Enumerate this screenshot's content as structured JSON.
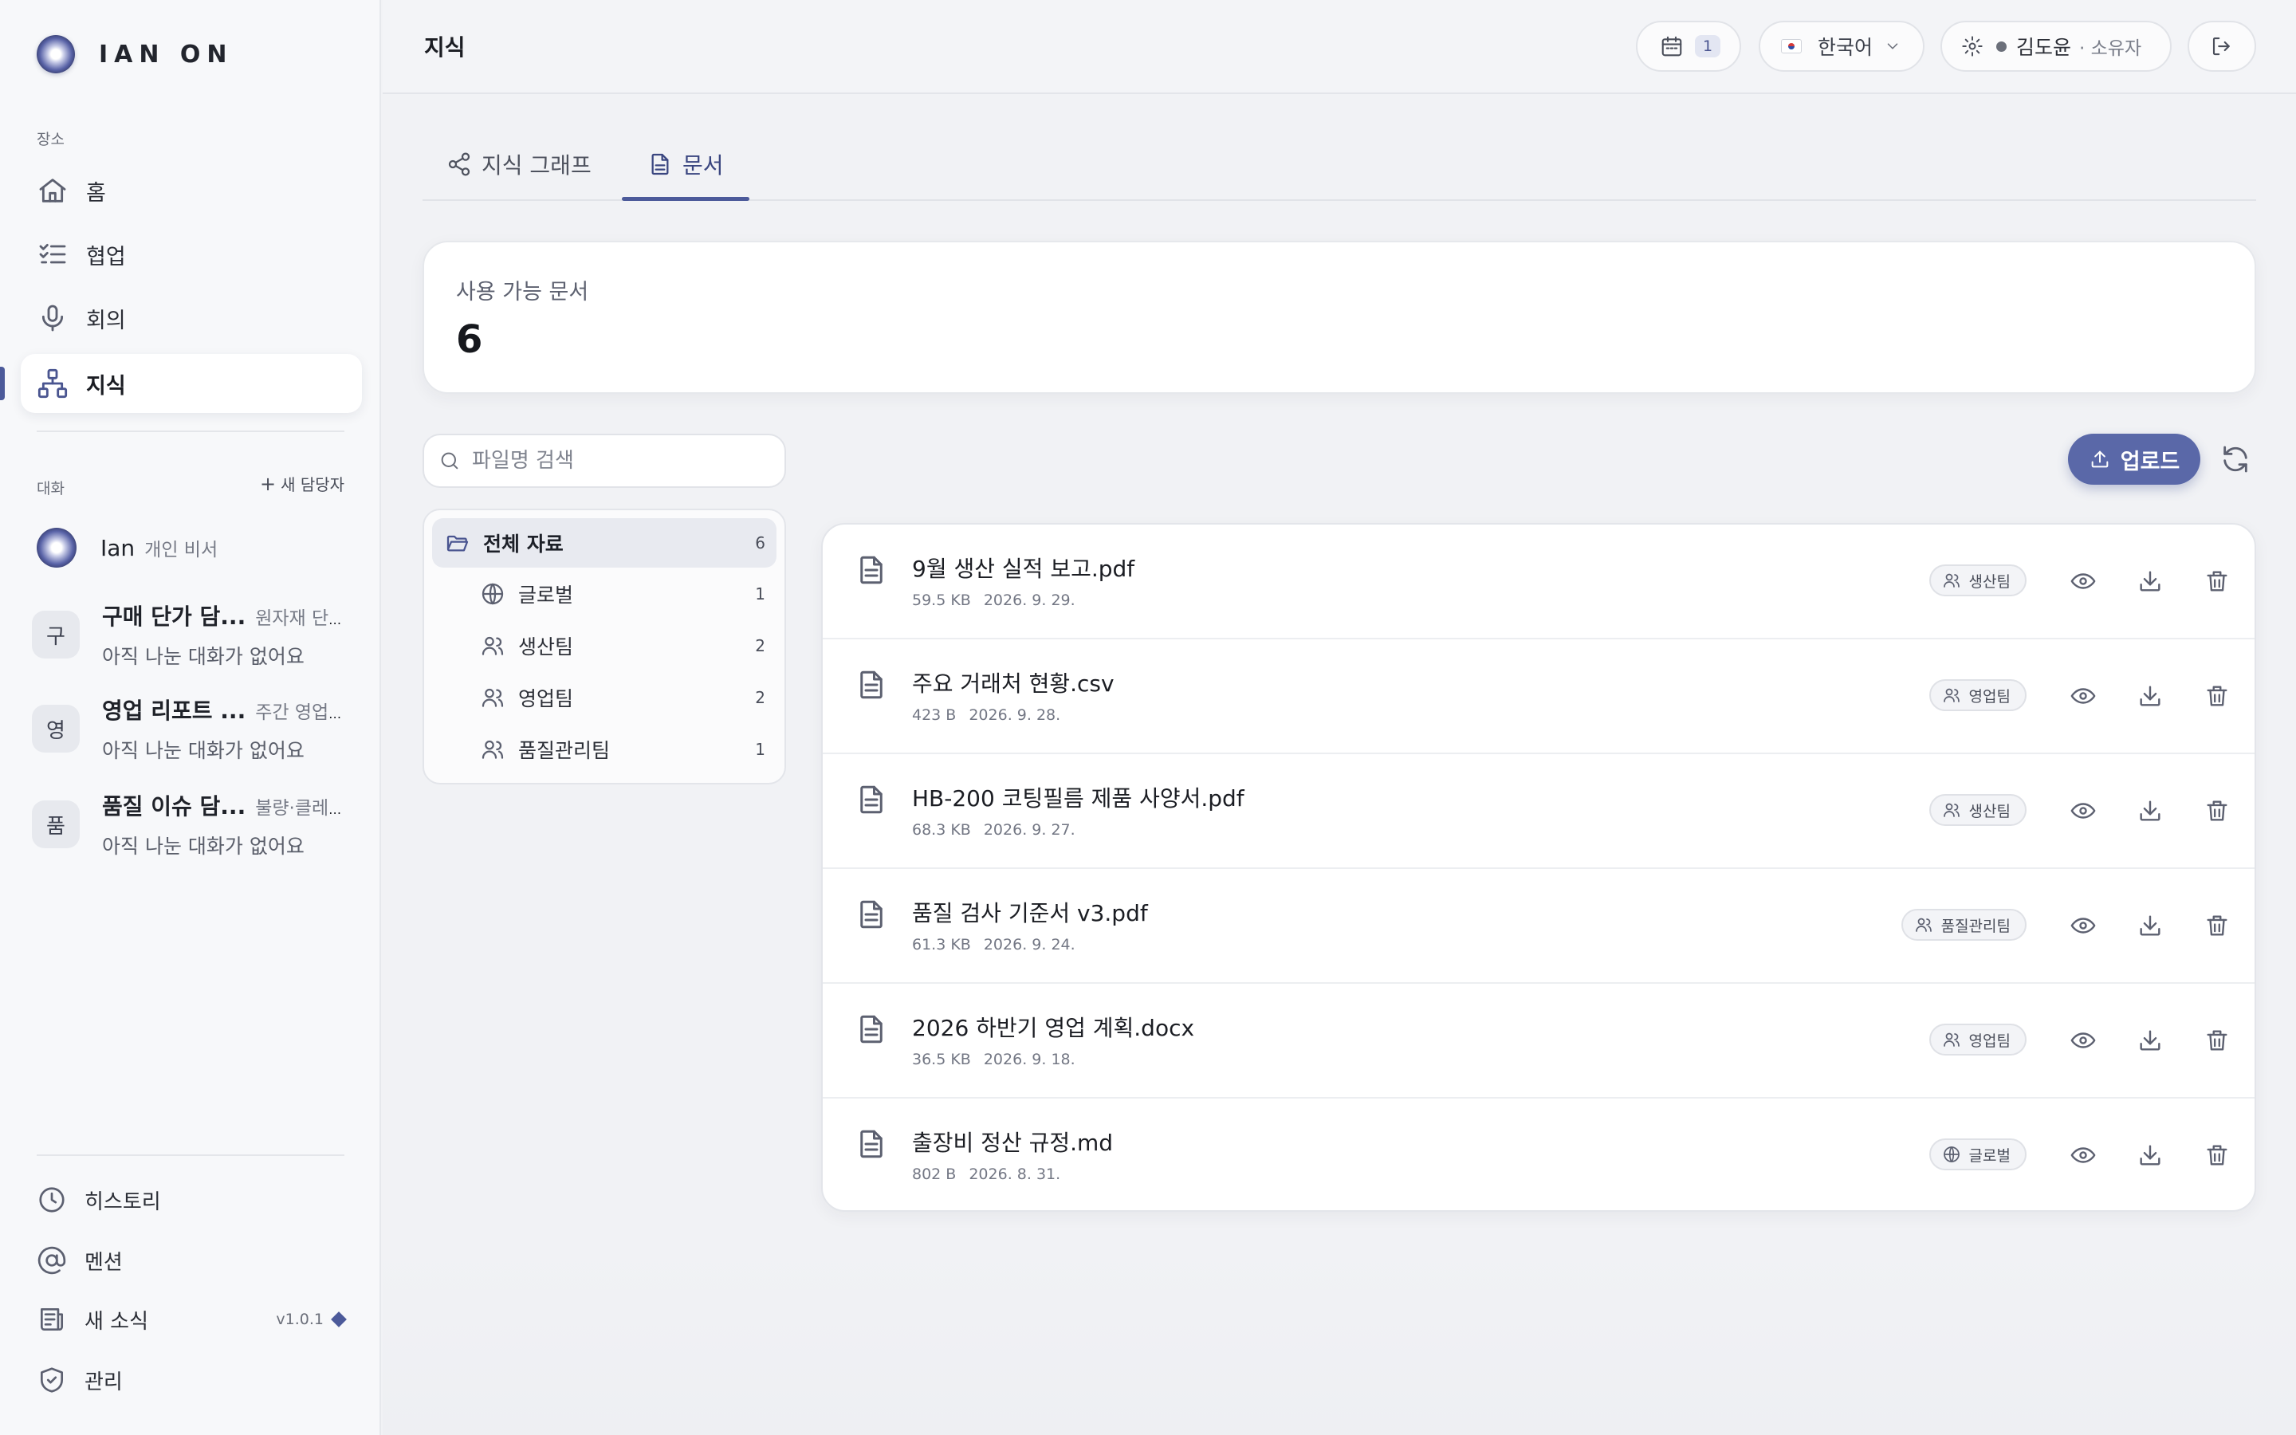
{
  "brand": {
    "name": "IAN ON"
  },
  "sidebar": {
    "section_places": "장소",
    "nav": [
      {
        "label": "홈",
        "icon": "home-icon"
      },
      {
        "label": "협업",
        "icon": "checklist-icon"
      },
      {
        "label": "회의",
        "icon": "microphone-icon"
      },
      {
        "label": "지식",
        "icon": "network-icon",
        "active": true
      }
    ],
    "section_conversations": "대화",
    "new_agent": "새 담당자",
    "conversations": [
      {
        "avatar": "",
        "name": "Ian",
        "hint": "개인 비서",
        "sub": ""
      },
      {
        "avatar": "구",
        "name": "구매 단가 담...",
        "hint": "원자재 단...",
        "sub": "아직 나눈 대화가 없어요"
      },
      {
        "avatar": "영",
        "name": "영업 리포트 ...",
        "hint": "주간 영업 ...",
        "sub": "아직 나눈 대화가 없어요"
      },
      {
        "avatar": "품",
        "name": "품질 이슈 담...",
        "hint": "불량·클레...",
        "sub": "아직 나눈 대화가 없어요"
      }
    ],
    "bottom": [
      {
        "label": "히스토리",
        "icon": "clock-icon"
      },
      {
        "label": "멘션",
        "icon": "at-icon"
      },
      {
        "label": "새 소식",
        "icon": "newspaper-icon",
        "version": "v1.0.1"
      },
      {
        "label": "관리",
        "icon": "shield-icon"
      }
    ]
  },
  "topbar": {
    "title": "지식",
    "calendar_count": "1",
    "language": "한국어",
    "user_name": "김도윤",
    "user_role": "· 소유자"
  },
  "tabs": [
    {
      "label": "지식 그래프",
      "icon": "share-graph-icon"
    },
    {
      "label": "문서",
      "icon": "document-icon",
      "active": true
    }
  ],
  "summary": {
    "label": "사용 가능 문서",
    "value": "6"
  },
  "search": {
    "placeholder": "파일명 검색",
    "value": ""
  },
  "upload_label": "업로드",
  "folders": [
    {
      "label": "전체 자료",
      "count": "6",
      "icon": "folder-open-icon",
      "active": true
    },
    {
      "label": "글로벌",
      "count": "1",
      "icon": "globe-icon"
    },
    {
      "label": "생산팀",
      "count": "2",
      "icon": "users-icon"
    },
    {
      "label": "영업팀",
      "count": "2",
      "icon": "users-icon"
    },
    {
      "label": "품질관리팀",
      "count": "1",
      "icon": "users-icon"
    }
  ],
  "documents": [
    {
      "name": "9월 생산 실적 보고.pdf",
      "size": "59.5 KB",
      "date": "2026. 9. 29.",
      "team": "생산팀",
      "team_icon": "users-icon"
    },
    {
      "name": "주요 거래처 현황.csv",
      "size": "423 B",
      "date": "2026. 9. 28.",
      "team": "영업팀",
      "team_icon": "users-icon"
    },
    {
      "name": "HB-200 코팅필름 제품 사양서.pdf",
      "size": "68.3 KB",
      "date": "2026. 9. 27.",
      "team": "생산팀",
      "team_icon": "users-icon"
    },
    {
      "name": "품질 검사 기준서 v3.pdf",
      "size": "61.3 KB",
      "date": "2026. 9. 24.",
      "team": "품질관리팀",
      "team_icon": "users-icon"
    },
    {
      "name": "2026 하반기 영업 계획.docx",
      "size": "36.5 KB",
      "date": "2026. 9. 18.",
      "team": "영업팀",
      "team_icon": "users-icon"
    },
    {
      "name": "출장비 정산 규정.md",
      "size": "802 B",
      "date": "2026. 8. 31.",
      "team": "글로벌",
      "team_icon": "globe-icon"
    }
  ],
  "colors": {
    "accent": "#4c5a9a",
    "upload_button": "#5a68a8",
    "background": "#f1f2f5"
  }
}
